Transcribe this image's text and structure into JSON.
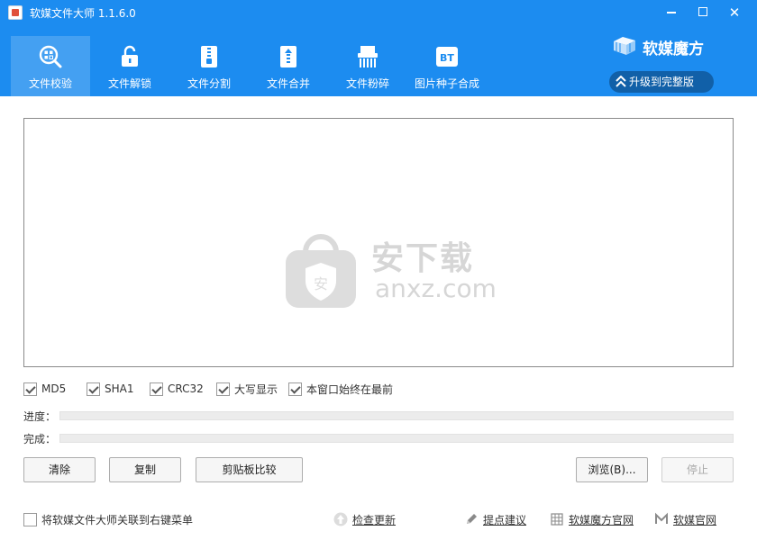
{
  "app": {
    "title": "软媒文件大师 1.1.6.0",
    "brand_name": "软媒魔方",
    "upgrade_label": "升级到完整版",
    "accent_color": "#1c8cf0"
  },
  "tabs": [
    {
      "label": "文件校验",
      "icon": "magnifier-qr-icon",
      "active": true
    },
    {
      "label": "文件解锁",
      "icon": "unlock-icon",
      "active": false
    },
    {
      "label": "文件分割",
      "icon": "zipper-file-icon",
      "active": false
    },
    {
      "label": "文件合并",
      "icon": "merge-file-icon",
      "active": false
    },
    {
      "label": "文件粉碎",
      "icon": "shredder-icon",
      "active": false
    },
    {
      "label": "图片种子合成",
      "icon": "bt-icon",
      "active": false
    }
  ],
  "output": {
    "watermark_cn": "安下载",
    "watermark_en": "anxz.com",
    "watermark_shield": "安"
  },
  "options": [
    {
      "label": "MD5",
      "checked": true
    },
    {
      "label": "SHA1",
      "checked": true
    },
    {
      "label": "CRC32",
      "checked": true
    },
    {
      "label": "大写显示",
      "checked": true
    },
    {
      "label": "本窗口始终在最前",
      "checked": true
    }
  ],
  "progress": {
    "progress_label": "进度：",
    "progress_value": 0,
    "complete_label": "完成：",
    "complete_value": 0
  },
  "buttons": {
    "clear": "清除",
    "copy": "复制",
    "clipboard_compare": "剪贴板比较",
    "browse": "浏览(B)...",
    "stop": "停止"
  },
  "footer": {
    "context_menu_label": "将软媒文件大师关联到右键菜单",
    "context_menu_checked": false,
    "check_update": "检查更新",
    "suggest": "提点建议",
    "mofang_site": "软媒魔方官网",
    "ruanmei_site": "软媒官网"
  }
}
